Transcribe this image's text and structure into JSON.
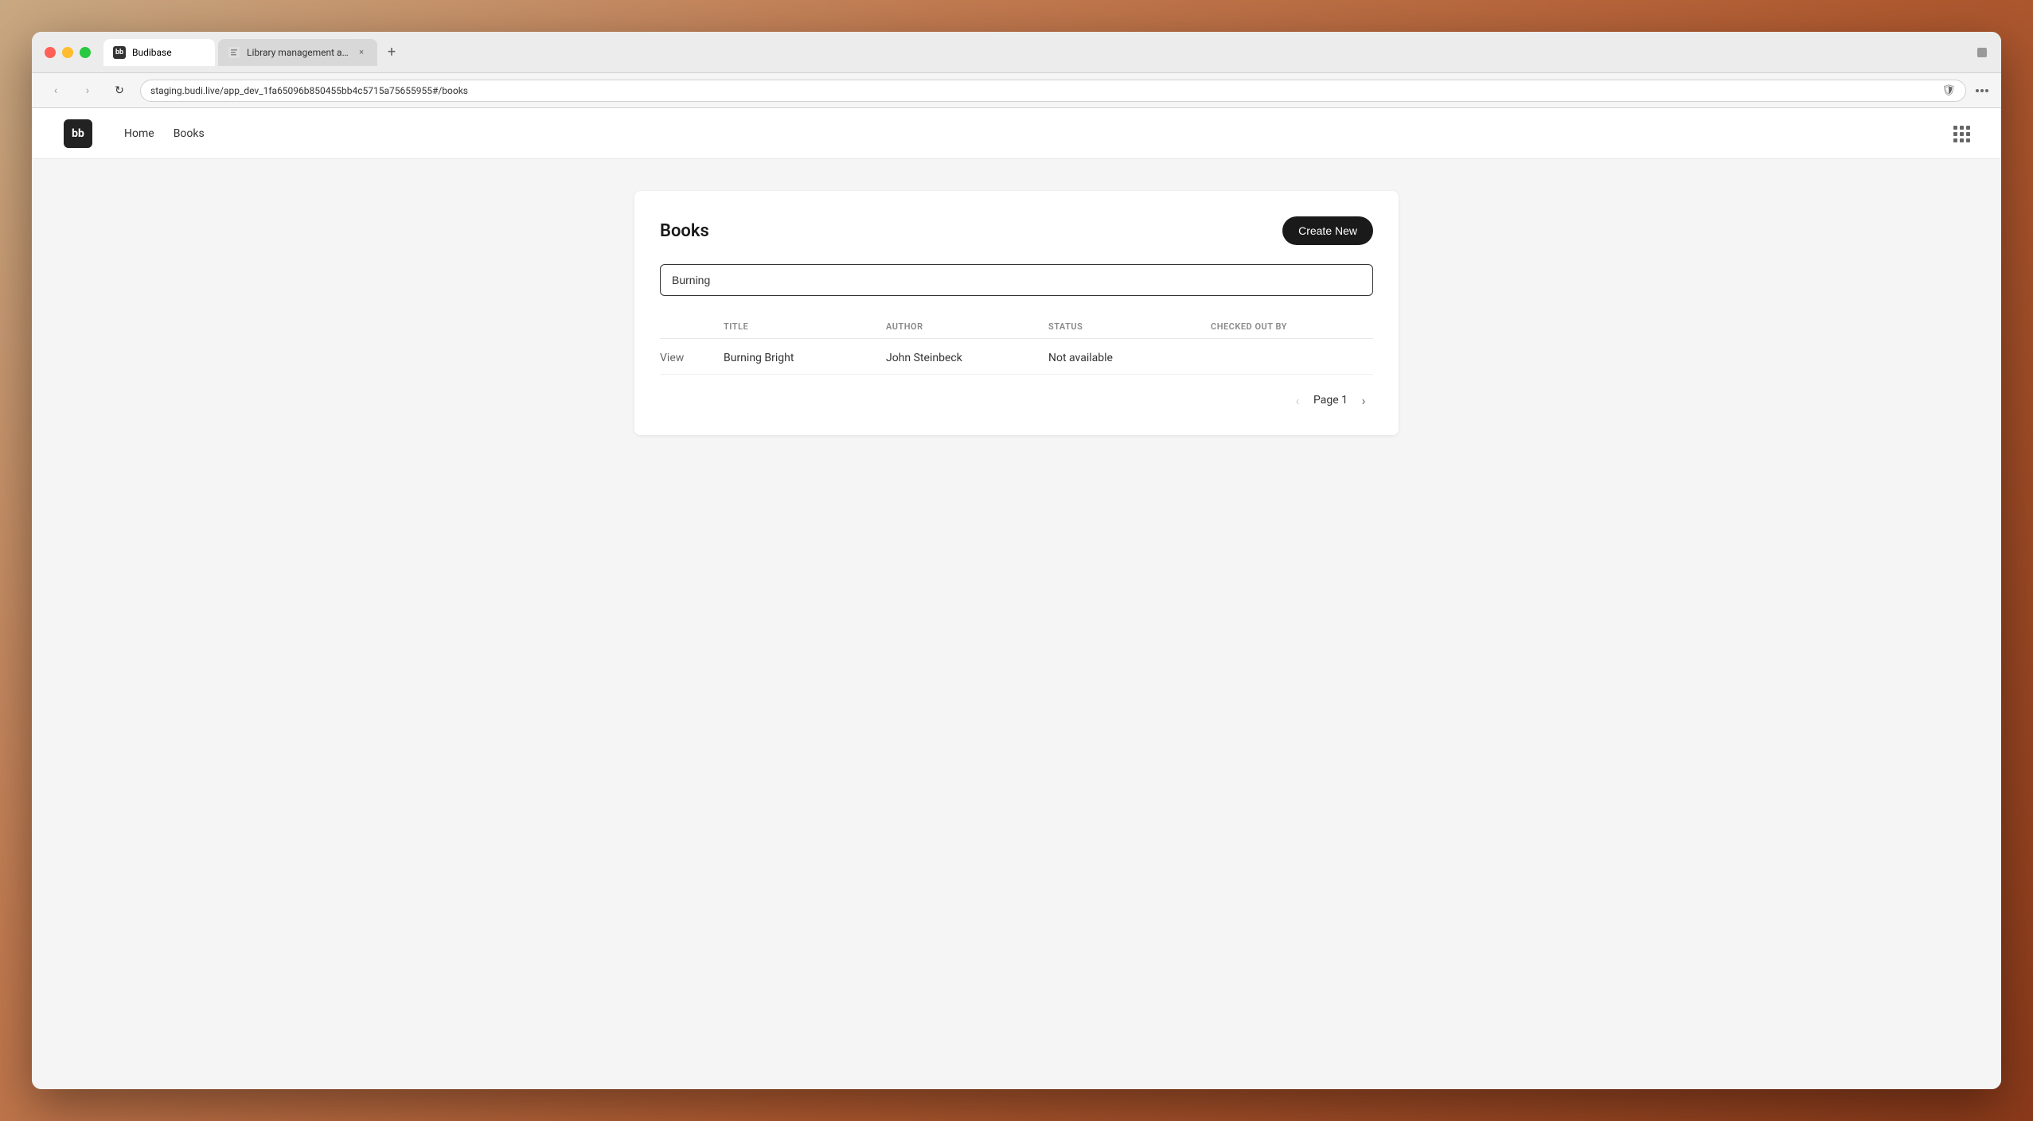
{
  "browser": {
    "tab1": {
      "label": "Budibase",
      "favicon": "bb"
    },
    "tab2": {
      "label": "Library management app",
      "favicon": "page"
    },
    "address": "staging.budi.live/app_dev_1fa65096b850455bb4c5715a75655955#/books",
    "new_tab_icon": "+"
  },
  "nav": {
    "back_icon": "‹",
    "forward_icon": "›",
    "reload_icon": "↻"
  },
  "app": {
    "logo": "bb",
    "nav_items": [
      {
        "label": "Home"
      },
      {
        "label": "Books"
      }
    ],
    "grid_icon": "grid"
  },
  "page": {
    "title": "Books",
    "create_button": "Create New",
    "search_value": "Burning",
    "search_placeholder": "",
    "table": {
      "columns": [
        {
          "key": "action",
          "label": ""
        },
        {
          "key": "title",
          "label": "TITLE"
        },
        {
          "key": "author",
          "label": "AUTHOR"
        },
        {
          "key": "status",
          "label": "STATUS"
        },
        {
          "key": "checked_out_by",
          "label": "CHECKED OUT BY"
        }
      ],
      "rows": [
        {
          "action": "View",
          "title": "Burning Bright",
          "author": "John Steinbeck",
          "status": "Not available",
          "checked_out_by": ""
        }
      ]
    },
    "pagination": {
      "prev_icon": "‹",
      "next_icon": "›",
      "page_text": "Page 1"
    }
  }
}
